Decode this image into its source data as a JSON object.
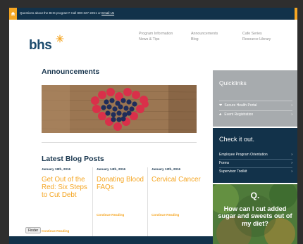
{
  "topbar": {
    "message": "Questions about the BHS program? Call 800-327-2251 or",
    "link_text": "Email Us"
  },
  "logo": {
    "text": "bhs"
  },
  "nav": {
    "column1": [
      "Program Information",
      "News & Tips"
    ],
    "column2": [
      "Announcements",
      "Blog"
    ],
    "column3": [
      "Cafe Series",
      "Resource Library"
    ]
  },
  "announcements": {
    "title": "Announcements"
  },
  "blog": {
    "title": "Latest Blog Posts",
    "continue_label": "Continue Reading",
    "posts": [
      {
        "date": "January 19th, 2016",
        "title": "Get Out of the Red: Six Steps to Cut Debt"
      },
      {
        "date": "January 14th, 2016",
        "title": "Donating Blood FAQs"
      },
      {
        "date": "January 12th, 2016",
        "title": "Cervical Cancer"
      }
    ]
  },
  "quicklinks": {
    "title": "Quicklinks",
    "items": [
      {
        "icon": "heart-icon",
        "label": "Secure Health Portal",
        "chevron": "›"
      },
      {
        "icon": "people-icon",
        "label": "Event Registration",
        "chevron": "›"
      }
    ]
  },
  "checkitout": {
    "title": "Check it out.",
    "items": [
      {
        "label": "Employee Program Orientation",
        "chevron": "›"
      },
      {
        "label": "Forms",
        "chevron": "›"
      },
      {
        "label": "Supervisor Toolkit",
        "chevron": "›"
      }
    ]
  },
  "promo": {
    "q": "Q.",
    "text": "How can I cut added sugar and sweets out of my diet?"
  },
  "dock": {
    "tooltip": "Finder"
  },
  "colors": {
    "navy": "#12324a",
    "orange": "#f5a623",
    "heading": "#1b3850",
    "quicklinks_bg": "#a7abae",
    "promo_green": "#4e7a3a"
  }
}
